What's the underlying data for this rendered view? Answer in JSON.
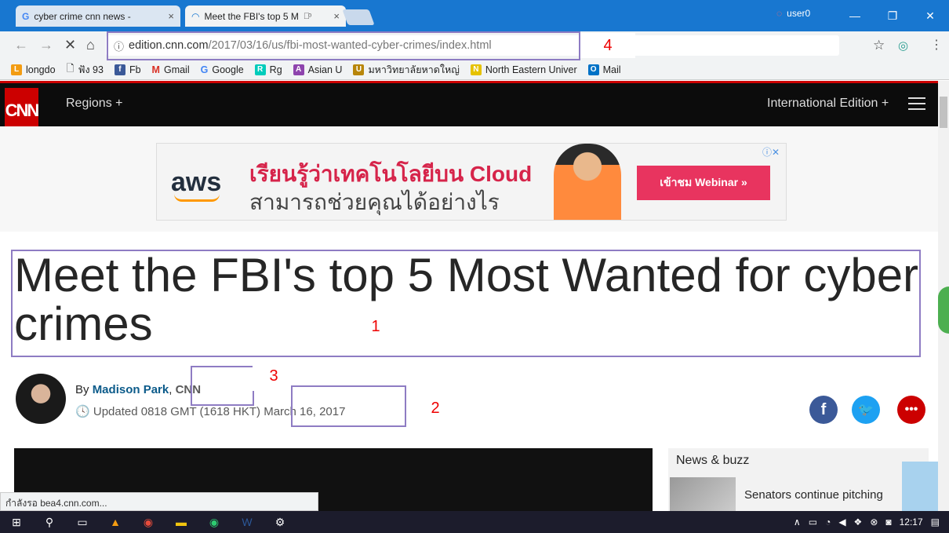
{
  "browser": {
    "tabs": [
      {
        "title": "cyber crime cnn news - ",
        "close": "×"
      },
      {
        "title": "Meet the FBI's top 5 M",
        "close": "×"
      }
    ],
    "user": "user0",
    "url_host": "edition.cnn.com",
    "url_path": "/2017/03/16/us/fbi-most-wanted-cyber-crimes/index.html",
    "bookmarks": [
      "longdo",
      "ฟัง 93",
      "Fb",
      "Gmail",
      "Google",
      "Rg",
      "Asian U",
      "มหาวิทยาลัยหาดใหญ่",
      "North Eastern Univer",
      "Mail"
    ],
    "status_text": "กำลังรอ bea4.cnn.com..."
  },
  "cnn": {
    "logo": "CNN",
    "regions": "Regions +",
    "edition": "International Edition +"
  },
  "ad": {
    "brand": "aws",
    "line1": "เรียนรู้ว่าเทคโนโลยีบน Cloud",
    "line2": "สามารถช่วยคุณได้อย่างไร",
    "cta": "เข้าชม Webinar »",
    "adchoices": "ⓘ✕"
  },
  "article": {
    "headline": "Meet the FBI's top 5 Most Wanted for cyber crimes",
    "by": "By",
    "author": "Madison Park",
    "source": "CNN",
    "updated": "Updated 0818 GMT (1618 HKT)",
    "date": "March 16, 2017"
  },
  "annotations": [
    "1",
    "2",
    "3",
    "4"
  ],
  "sidebar": {
    "title": "News & buzz",
    "item": "Senators continue pitching"
  },
  "taskbar": {
    "time": "12:17"
  }
}
